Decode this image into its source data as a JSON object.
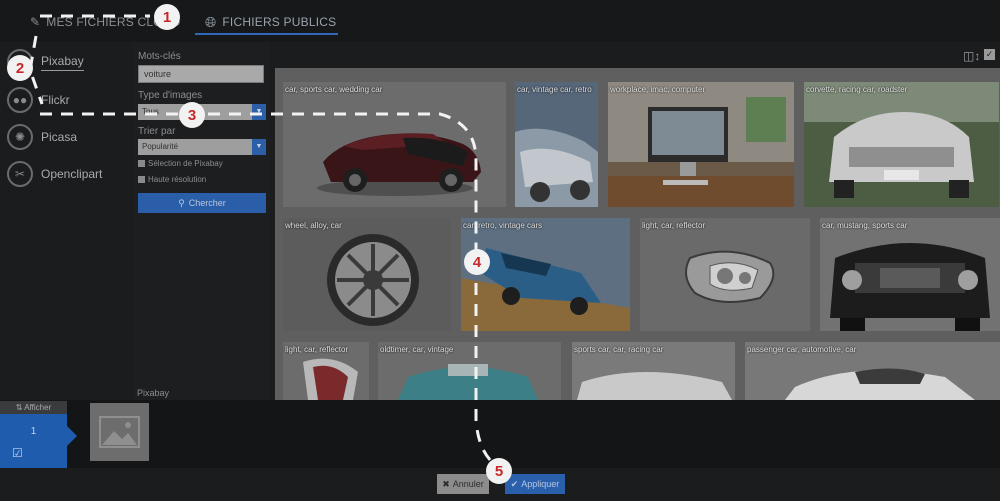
{
  "tabs": {
    "cloud": "MES FICHIERS CLOUD",
    "public": "FICHIERS PUBLICS"
  },
  "providers": [
    {
      "label": "Pixabay",
      "icon": "pixabay-icon"
    },
    {
      "label": "Flickr",
      "icon": "flickr-icon"
    },
    {
      "label": "Picasa",
      "icon": "picasa-icon"
    },
    {
      "label": "Openclipart",
      "icon": "openclipart-icon"
    }
  ],
  "search": {
    "keywords_label": "Mots-clés",
    "keywords_value": "voiture",
    "type_label": "Type d'images",
    "type_value": "Tous",
    "sort_label": "Trier par",
    "sort_value": "Popularité",
    "check_selection": "Sélection de Pixabay",
    "check_hires": "Haute résolution",
    "search_button": "Chercher",
    "provider_footer": "Pixabay"
  },
  "grid": {
    "tiles": [
      {
        "caption": "car, sports car, wedding car"
      },
      {
        "caption": "car, vintage car, retro"
      },
      {
        "caption": "workplace, imac, computer"
      },
      {
        "caption": "corvette, racing car, roadster"
      },
      {
        "caption": "wheel, alloy, car"
      },
      {
        "caption": "car, retro, vintage cars"
      },
      {
        "caption": "light, car, reflector"
      },
      {
        "caption": "car, mustang, sports car"
      },
      {
        "caption": "light, car, reflector"
      },
      {
        "caption": "oldtimer, car, vintage"
      },
      {
        "caption": "sports car, car, racing car"
      },
      {
        "caption": "passenger car, automotive, car"
      }
    ]
  },
  "tray": {
    "show_label": "⇅ Afficher",
    "selected_count": "1"
  },
  "footer": {
    "cancel": "Annuler",
    "apply": "Appliquer"
  },
  "callouts": [
    "1",
    "2",
    "3",
    "4",
    "5"
  ],
  "colors": {
    "accent": "#2a5fab",
    "callout_text": "#c62828",
    "callout_bg": "#f2f2f2"
  }
}
